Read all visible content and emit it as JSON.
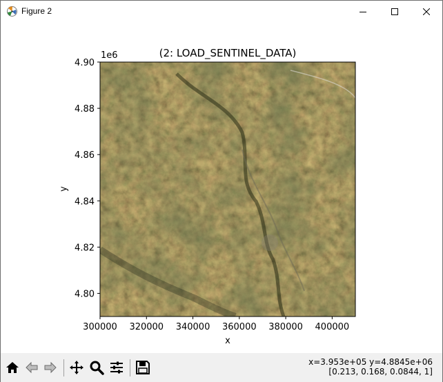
{
  "window": {
    "title": "Figure 2",
    "minimize_icon": "minimize-icon",
    "maximize_icon": "maximize-icon",
    "close_icon": "close-icon"
  },
  "chart_data": {
    "type": "image",
    "title": "(2: LOAD_SENTINEL_DATA)",
    "xlabel": "x",
    "ylabel": "y",
    "y_offset_label": "1e6",
    "xlim": [
      300000,
      410000
    ],
    "ylim": [
      4790000,
      4900000
    ],
    "x_ticks": [
      300000,
      320000,
      340000,
      360000,
      380000,
      400000
    ],
    "x_tick_labels": [
      "300000",
      "320000",
      "340000",
      "360000",
      "380000",
      "400000"
    ],
    "y_ticks": [
      4.8,
      4.82,
      4.84,
      4.86,
      4.88,
      4.9
    ],
    "y_tick_labels": [
      "4.80",
      "4.82",
      "4.84",
      "4.86",
      "4.88",
      "4.90"
    ],
    "grid": false,
    "image_description_colors": {
      "base": "#4a3a22",
      "dark": "#2e2a16",
      "green": "#2f3a1c",
      "light": "#6b5433"
    }
  },
  "toolbar": {
    "items": [
      {
        "name": "home-icon",
        "label": "Home"
      },
      {
        "name": "back-icon",
        "label": "Back"
      },
      {
        "name": "forward-icon",
        "label": "Forward"
      },
      {
        "name": "pan-icon",
        "label": "Pan"
      },
      {
        "name": "zoom-icon",
        "label": "Zoom"
      },
      {
        "name": "configure-subplots-icon",
        "label": "Subplots"
      },
      {
        "name": "save-icon",
        "label": "Save"
      }
    ],
    "coords_line1": "x=3.953e+05 y=4.8845e+06",
    "coords_line2": "[0.213, 0.168, 0.0844, 1]"
  }
}
